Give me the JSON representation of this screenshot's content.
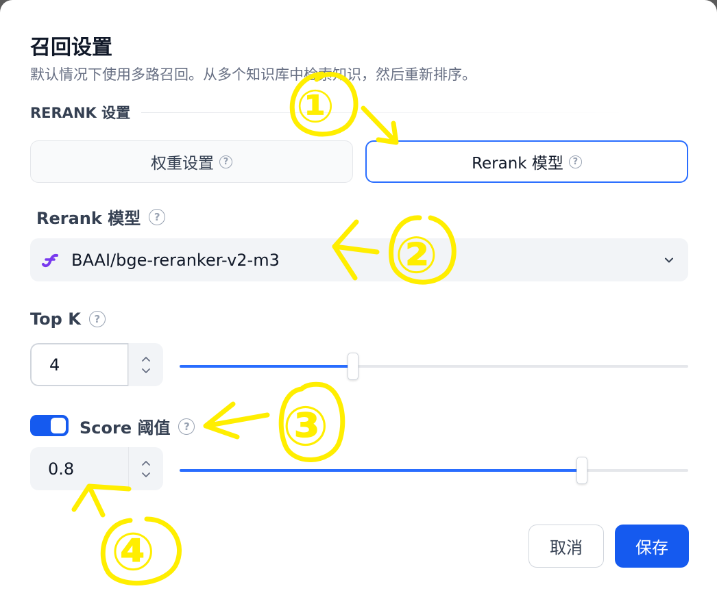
{
  "dialog": {
    "title": "召回设置",
    "subtitle": "默认情况下使用多路召回。从多个知识库中检索知识，然后重新排序。"
  },
  "rerank_section": {
    "label": "RERANK 设置",
    "tabs": [
      {
        "label": "权重设置",
        "selected": false
      },
      {
        "label": "Rerank 模型",
        "selected": true
      }
    ]
  },
  "rerank_model": {
    "label": "Rerank 模型",
    "selected_model": "BAAI/bge-reranker-v2-m3",
    "icon": "model-provider-icon"
  },
  "top_k": {
    "label": "Top K",
    "value": "4",
    "slider_fraction": 0.34
  },
  "score_threshold": {
    "label": "Score 阈值",
    "enabled": true,
    "value": "0.8",
    "slider_fraction": 0.79
  },
  "footer": {
    "cancel_label": "取消",
    "save_label": "保存"
  },
  "annotations": [
    "①",
    "②",
    "③",
    "④"
  ],
  "colors": {
    "accent": "#155aef",
    "tab_border": "#296dff",
    "highlight": "#ffee00"
  }
}
